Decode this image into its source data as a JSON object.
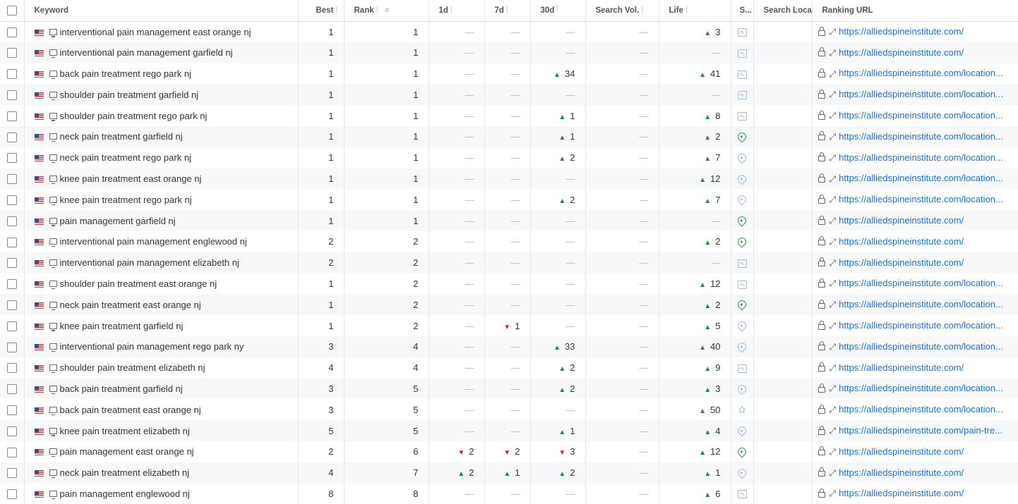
{
  "columns": {
    "keyword": "Keyword",
    "best": "Best",
    "rank": "Rank",
    "d1": "1d",
    "d7": "7d",
    "d30": "30d",
    "search_vol": "Search Vol.",
    "life": "Life",
    "serp": "S...",
    "search_location": "Search Locat",
    "ranking_url": "Ranking URL"
  },
  "colors": {
    "up": "#1a8f2e",
    "down": "#d2281e",
    "link": "#1f6fd1",
    "serp_image": "#9bbde3",
    "serp_pin_green": "#2e9a4a",
    "serp_pin_blue": "#9bbde3"
  },
  "rows": [
    {
      "keyword": "interventional pain management east orange nj",
      "best": "1",
      "rank": "1",
      "d1": null,
      "d7": null,
      "d30": null,
      "life": {
        "dir": "up",
        "val": "3"
      },
      "serp": "image",
      "url": "https://alliedspineinstitute.com/"
    },
    {
      "keyword": "interventional pain management garfield nj",
      "best": "1",
      "rank": "1",
      "d1": null,
      "d7": null,
      "d30": null,
      "life": null,
      "serp": "image",
      "url": "https://alliedspineinstitute.com/"
    },
    {
      "keyword": "back pain treatment rego park nj",
      "best": "1",
      "rank": "1",
      "d1": null,
      "d7": null,
      "d30": {
        "dir": "up",
        "val": "34"
      },
      "life": {
        "dir": "up",
        "val": "41"
      },
      "serp": "image",
      "url": "https://alliedspineinstitute.com/location..."
    },
    {
      "keyword": "shoulder pain treatment garfield nj",
      "best": "1",
      "rank": "1",
      "d1": null,
      "d7": null,
      "d30": null,
      "life": null,
      "serp": "image",
      "url": "https://alliedspineinstitute.com/location..."
    },
    {
      "keyword": "shoulder pain treatment rego park nj",
      "best": "1",
      "rank": "1",
      "d1": null,
      "d7": null,
      "d30": {
        "dir": "up",
        "val": "1"
      },
      "life": {
        "dir": "up",
        "val": "8"
      },
      "serp": "image",
      "url": "https://alliedspineinstitute.com/location..."
    },
    {
      "keyword": "neck pain treatment garfield nj",
      "best": "1",
      "rank": "1",
      "d1": null,
      "d7": null,
      "d30": {
        "dir": "up",
        "val": "1"
      },
      "life": {
        "dir": "up",
        "val": "2"
      },
      "serp": "pin-green",
      "url": "https://alliedspineinstitute.com/location..."
    },
    {
      "keyword": "neck pain treatment rego park nj",
      "best": "1",
      "rank": "1",
      "d1": null,
      "d7": null,
      "d30": {
        "dir": "up",
        "val": "2"
      },
      "life": {
        "dir": "up",
        "val": "7"
      },
      "serp": "pin-blue",
      "url": "https://alliedspineinstitute.com/location..."
    },
    {
      "keyword": "knee pain treatment east orange nj",
      "best": "1",
      "rank": "1",
      "d1": null,
      "d7": null,
      "d30": null,
      "life": {
        "dir": "up",
        "val": "12"
      },
      "serp": "pin-blue",
      "url": "https://alliedspineinstitute.com/location..."
    },
    {
      "keyword": "knee pain treatment rego park nj",
      "best": "1",
      "rank": "1",
      "d1": null,
      "d7": null,
      "d30": {
        "dir": "up",
        "val": "2"
      },
      "life": {
        "dir": "up",
        "val": "7"
      },
      "serp": "pin-blue",
      "url": "https://alliedspineinstitute.com/location..."
    },
    {
      "keyword": "pain management garfield nj",
      "best": "1",
      "rank": "1",
      "d1": null,
      "d7": null,
      "d30": null,
      "life": null,
      "serp": "pin-green",
      "url": "https://alliedspineinstitute.com/"
    },
    {
      "keyword": "interventional pain management englewood nj",
      "best": "2",
      "rank": "2",
      "d1": null,
      "d7": null,
      "d30": null,
      "life": {
        "dir": "up",
        "val": "2"
      },
      "serp": "pin-green",
      "url": "https://alliedspineinstitute.com/"
    },
    {
      "keyword": "interventional pain management elizabeth nj",
      "best": "2",
      "rank": "2",
      "d1": null,
      "d7": null,
      "d30": null,
      "life": null,
      "serp": "image",
      "url": "https://alliedspineinstitute.com/"
    },
    {
      "keyword": "shoulder pain treatment east orange nj",
      "best": "1",
      "rank": "2",
      "d1": null,
      "d7": null,
      "d30": null,
      "life": {
        "dir": "up",
        "val": "12"
      },
      "serp": "image",
      "url": "https://alliedspineinstitute.com/location..."
    },
    {
      "keyword": "neck pain treatment east orange nj",
      "best": "1",
      "rank": "2",
      "d1": null,
      "d7": null,
      "d30": null,
      "life": {
        "dir": "up",
        "val": "2"
      },
      "serp": "pin-green",
      "url": "https://alliedspineinstitute.com/location..."
    },
    {
      "keyword": "knee pain treatment garfield nj",
      "best": "1",
      "rank": "2",
      "d1": null,
      "d7": {
        "dir": "down",
        "val": "1"
      },
      "d30": null,
      "life": {
        "dir": "up",
        "val": "5"
      },
      "serp": "pin-blue",
      "url": "https://alliedspineinstitute.com/location..."
    },
    {
      "keyword": "interventional pain management rego park ny",
      "best": "3",
      "rank": "4",
      "d1": null,
      "d7": null,
      "d30": {
        "dir": "up",
        "val": "33"
      },
      "life": {
        "dir": "up",
        "val": "40"
      },
      "serp": "pin-blue",
      "url": "https://alliedspineinstitute.com/location..."
    },
    {
      "keyword": "shoulder pain treatment elizabeth nj",
      "best": "4",
      "rank": "4",
      "d1": null,
      "d7": null,
      "d30": {
        "dir": "up",
        "val": "2"
      },
      "life": {
        "dir": "up",
        "val": "9"
      },
      "serp": "image",
      "url": "https://alliedspineinstitute.com/"
    },
    {
      "keyword": "back pain treatment garfield nj",
      "best": "3",
      "rank": "5",
      "d1": null,
      "d7": null,
      "d30": {
        "dir": "up",
        "val": "2"
      },
      "life": {
        "dir": "up",
        "val": "3"
      },
      "serp": "pin-blue",
      "url": "https://alliedspineinstitute.com/location..."
    },
    {
      "keyword": "back pain treatment east orange nj",
      "best": "3",
      "rank": "5",
      "d1": null,
      "d7": null,
      "d30": null,
      "life": {
        "dir": "up",
        "val": "50"
      },
      "serp": "star",
      "url": "https://alliedspineinstitute.com/location..."
    },
    {
      "keyword": "knee pain treatment elizabeth nj",
      "best": "5",
      "rank": "5",
      "d1": null,
      "d7": null,
      "d30": {
        "dir": "up",
        "val": "1"
      },
      "life": {
        "dir": "up",
        "val": "4"
      },
      "serp": "pin-blue",
      "url": "https://alliedspineinstitute.com/pain-tre..."
    },
    {
      "keyword": "pain management east orange nj",
      "best": "2",
      "rank": "6",
      "d1": {
        "dir": "down",
        "val": "2"
      },
      "d7": {
        "dir": "down",
        "val": "2"
      },
      "d30": {
        "dir": "down",
        "val": "3"
      },
      "life": {
        "dir": "up",
        "val": "12"
      },
      "serp": "pin-green",
      "url": "https://alliedspineinstitute.com/"
    },
    {
      "keyword": "neck pain treatment elizabeth nj",
      "best": "4",
      "rank": "7",
      "d1": {
        "dir": "up",
        "val": "2"
      },
      "d7": {
        "dir": "up",
        "val": "1"
      },
      "d30": {
        "dir": "up",
        "val": "2"
      },
      "life": {
        "dir": "up",
        "val": "1"
      },
      "serp": "pin-blue",
      "url": "https://alliedspineinstitute.com/"
    },
    {
      "keyword": "pain management englewood nj",
      "best": "8",
      "rank": "8",
      "d1": null,
      "d7": null,
      "d30": null,
      "life": {
        "dir": "up",
        "val": "6"
      },
      "serp": "image",
      "url": "https://alliedspineinstitute.com/"
    }
  ]
}
